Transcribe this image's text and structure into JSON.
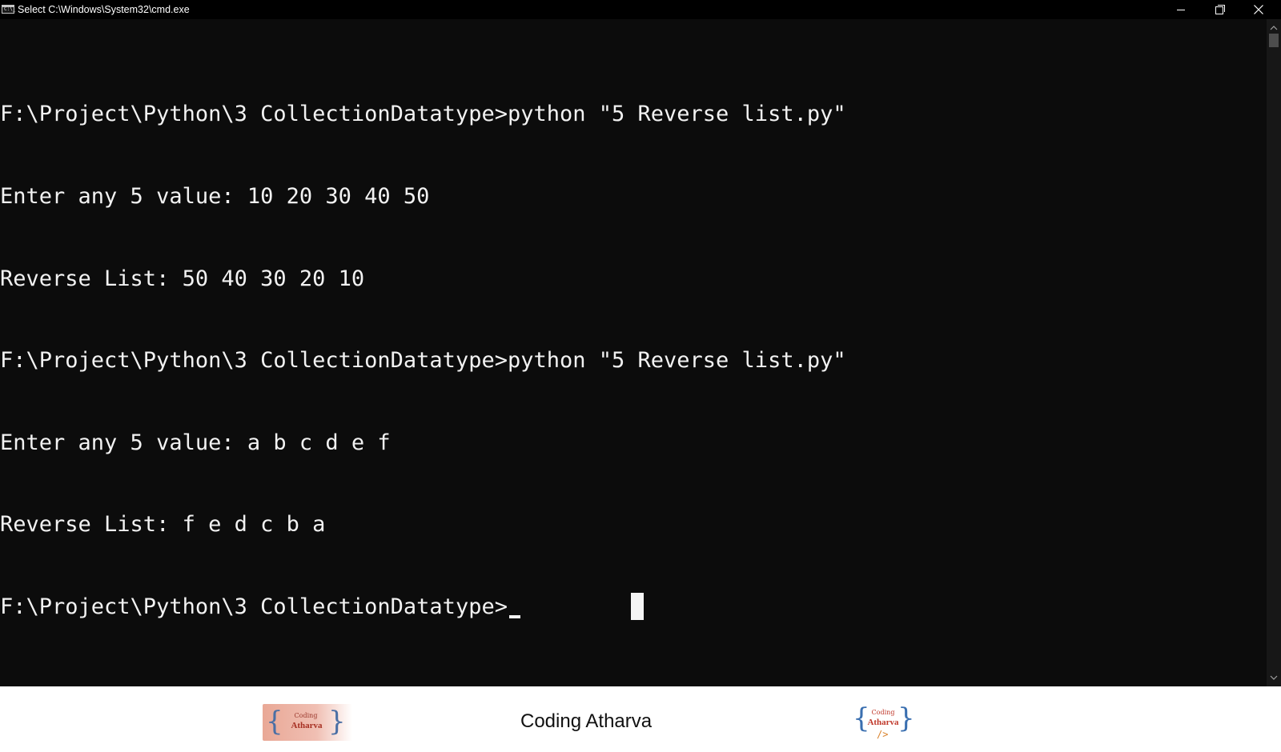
{
  "window": {
    "title": "Select C:\\Windows\\System32\\cmd.exe",
    "icon": "cmd-icon",
    "icon_text": "C:\\_"
  },
  "console": {
    "lines": [
      "",
      "F:\\Project\\Python\\3 CollectionDatatype>python \"5 Reverse list.py\"",
      "Enter any 5 value: 10 20 30 40 50",
      "Reverse List: 50 40 30 20 10",
      "F:\\Project\\Python\\3 CollectionDatatype>python \"5 Reverse list.py\"",
      "Enter any 5 value: a b c d e f",
      "Reverse List: f e d c b a",
      "F:\\Project\\Python\\3 CollectionDatatype>"
    ]
  },
  "footer": {
    "title": "Coding Atharva",
    "logo": {
      "small_text": "Coding",
      "bold_text": "Atharva",
      "left_brace": "{",
      "right_brace": "}",
      "slash_text": "/>"
    }
  },
  "colors": {
    "console_bg": "#0c0c0c",
    "console_text": "#f2f2f2",
    "titlebar_bg": "#000000"
  }
}
